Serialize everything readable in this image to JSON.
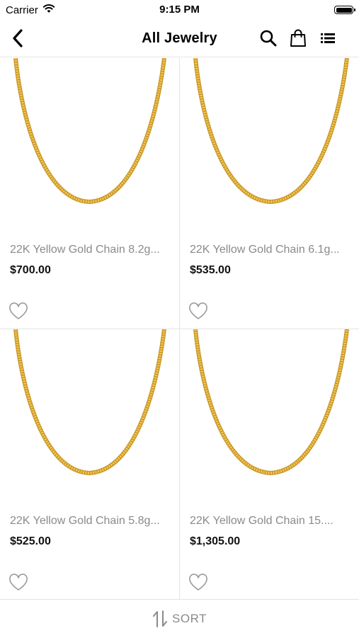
{
  "status": {
    "carrier": "Carrier",
    "time": "9:15 PM"
  },
  "nav": {
    "title": "All Jewelry"
  },
  "products": [
    {
      "title": "22K Yellow Gold Chain 8.2g...",
      "price": "$700.00"
    },
    {
      "title": "22K Yellow Gold Chain 6.1g...",
      "price": "$535.00"
    },
    {
      "title": "22K Yellow Gold Chain 5.8g...",
      "price": "$525.00"
    },
    {
      "title": "22K Yellow Gold Chain 15....",
      "price": "$1,305.00"
    }
  ],
  "sort": {
    "label": "SORT"
  },
  "colors": {
    "gold": "#e9b949",
    "gold_dark": "#c99524",
    "muted_text": "#8a8a8a"
  },
  "icons": [
    "wifi-icon",
    "battery-icon",
    "back-icon",
    "search-icon",
    "bag-icon",
    "list-icon",
    "heart-icon",
    "sort-icon"
  ]
}
